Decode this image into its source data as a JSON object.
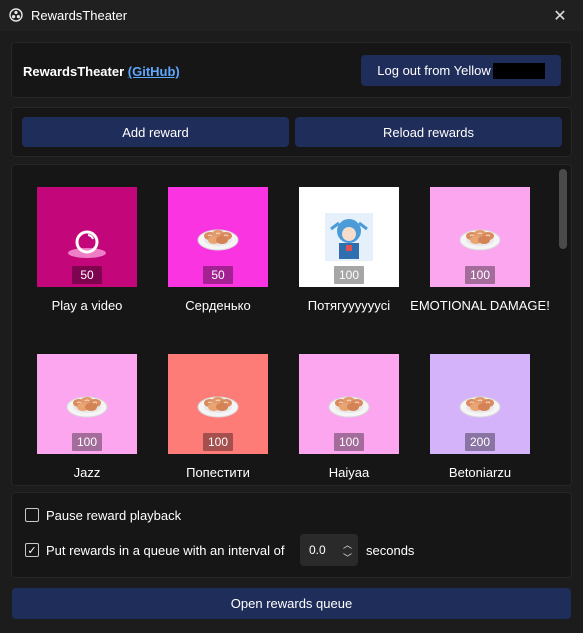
{
  "window": {
    "title": "RewardsTheater",
    "close_symbol": "✕"
  },
  "header": {
    "brand": "RewardsTheater",
    "github_link": "(GitHub)",
    "logout_label": "Log out from Yellow"
  },
  "actions": {
    "add_label": "Add reward",
    "reload_label": "Reload rewards"
  },
  "rewards": [
    {
      "name": "Play a video",
      "cost": "50",
      "bg": "#c3077a",
      "icon": "record-icon"
    },
    {
      "name": "Серденько",
      "cost": "50",
      "bg": "#fa34e0",
      "icon": "pastry-plate-icon"
    },
    {
      "name": "Потягууууууcі",
      "cost": "100",
      "bg": "#ffffff",
      "icon": "anime-character-image"
    },
    {
      "name": "EMOTIONAL DAMAGE!",
      "cost": "100",
      "bg": "#fba6ef",
      "icon": "pastry-plate-icon"
    },
    {
      "name": "Jazz",
      "cost": "100",
      "bg": "#fba6ef",
      "icon": "pastry-plate-icon"
    },
    {
      "name": "Попестити",
      "cost": "100",
      "bg": "#fd7c78",
      "icon": "pastry-plate-icon"
    },
    {
      "name": "Haiyaa",
      "cost": "100",
      "bg": "#fba6ef",
      "icon": "pastry-plate-icon"
    },
    {
      "name": "Betoniarzu",
      "cost": "200",
      "bg": "#d4b3fb",
      "icon": "pastry-plate-icon"
    }
  ],
  "options": {
    "pause_label": "Pause reward playback",
    "pause_checked": false,
    "queue_label": "Put rewards in a queue with an interval of",
    "queue_checked": true,
    "interval_value": "0.0",
    "seconds_label": "seconds"
  },
  "footer": {
    "open_queue_label": "Open rewards queue"
  },
  "colors": {
    "button": "#1f2d5a",
    "link": "#5ea7ff",
    "window_bg": "#1c1c1c",
    "panel_bg": "#161616"
  }
}
